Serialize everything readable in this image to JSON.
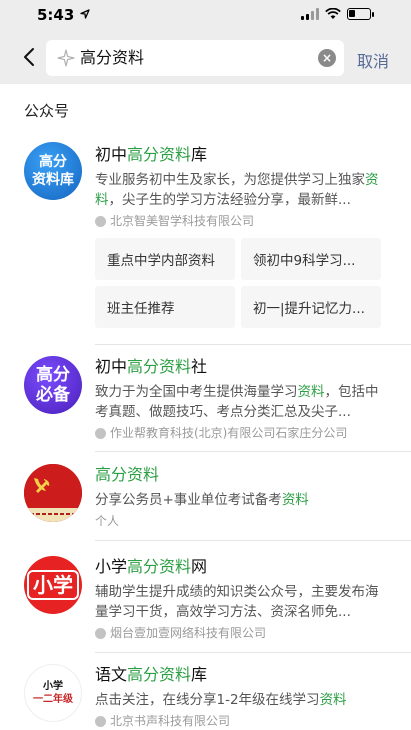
{
  "status_bar": {
    "time": "5:43"
  },
  "search": {
    "query": "高分资料",
    "cancel_label": "取消"
  },
  "section_title": "公众号",
  "results": [
    {
      "avatar_text": [
        "高分",
        "资料库"
      ],
      "title_pre": "初中",
      "title_hl": "高分资料",
      "title_post": "库",
      "desc_pre": "专业服务初中生及家长，为您提供学习上独家",
      "desc_hl": "资料",
      "desc_post": "，尖子生的学习方法经验分享，最新鲜...",
      "meta": "北京智美智学科技有限公司",
      "menu": [
        "重点中学内部资料",
        "领初中9科学习...",
        "班主任推荐",
        "初一|提升记忆力..."
      ]
    },
    {
      "avatar_text": [
        "高分",
        "必备"
      ],
      "title_pre": "初中",
      "title_hl": "高分资料",
      "title_post": "社",
      "desc_pre": "致力于为全国中考生提供海量学习",
      "desc_hl": "资料",
      "desc_post": "，包括中考真题、做题技巧、考点分类汇总及尖子...",
      "meta": "作业帮教育科技(北京)有限公司石家庄分公司"
    },
    {
      "avatar_text": [],
      "title_pre": "",
      "title_hl": "高分资料",
      "title_post": "",
      "desc_pre": "分享公务员+事业单位考试备考",
      "desc_hl": "资料",
      "desc_post": "",
      "meta": "个人"
    },
    {
      "avatar_text": [
        "小学"
      ],
      "title_pre": "小学",
      "title_hl": "高分资料",
      "title_post": "网",
      "desc_pre": "辅助学生提升成绩的知识类公众号，主要发布海量学习干货，高效学习方法、资深名师免...",
      "desc_hl": "",
      "desc_post": "",
      "meta": "烟台壹加壹网络科技有限公司"
    },
    {
      "avatar_text": [
        "小学",
        "一二年级"
      ],
      "title_pre": "语文",
      "title_hl": "高分资料",
      "title_post": "库",
      "desc_pre": "点击关注，在线分享1-2年级在线学习",
      "desc_hl": "资料",
      "desc_post": "",
      "meta": "北京书声科技有限公司"
    }
  ],
  "colors": {
    "highlight": "#2c9f45",
    "link": "#576b95",
    "avatar1": "#1e88e5",
    "avatar2": "#5e2bd6",
    "avatar3": "#d32020",
    "avatar4": "#e02020"
  },
  "icons": [
    "back-arrow-icon",
    "sparkle-search-icon",
    "clear-icon",
    "signal-icon",
    "wifi-icon",
    "battery-icon",
    "location-arrow-icon",
    "verified-icon"
  ]
}
